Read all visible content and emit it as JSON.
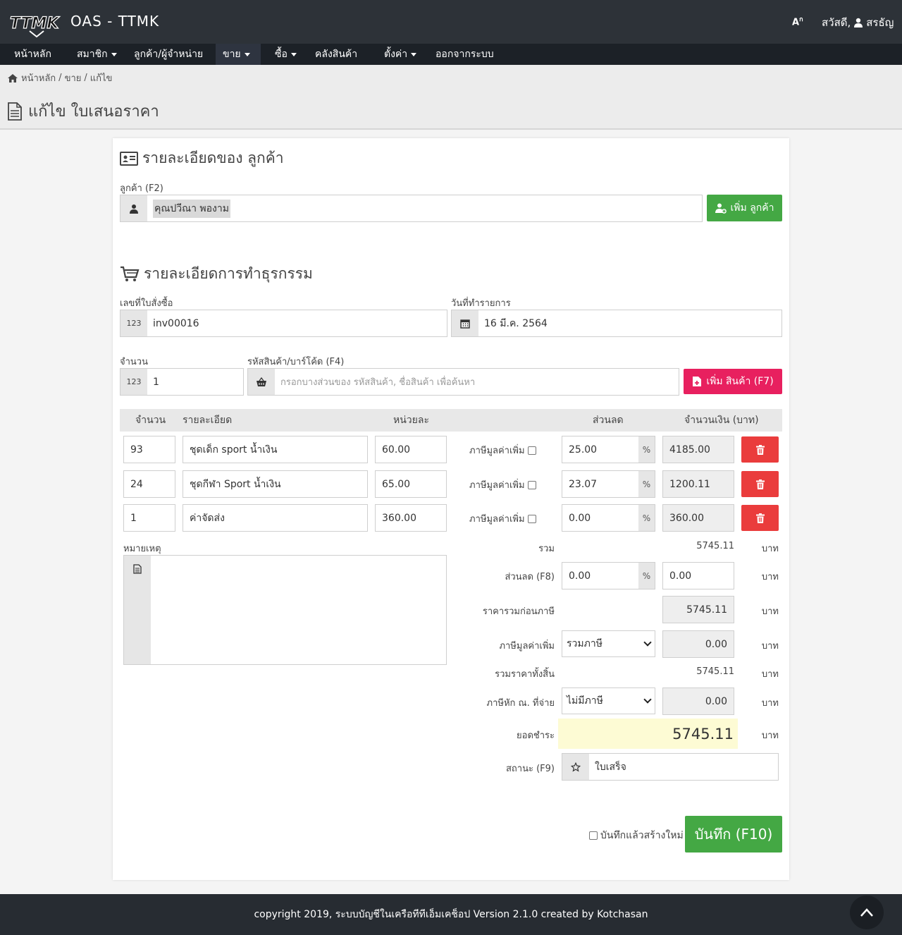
{
  "app": {
    "title": "OAS - TTMK",
    "logo_text": "TTMK"
  },
  "user": {
    "greeting": "สวัสดี,",
    "name": "สรธัญ",
    "lang_glyph": "A"
  },
  "menu": [
    {
      "label": "หน้าหลัก"
    },
    {
      "label": "สมาชิก"
    },
    {
      "label": "ลูกค้า/ผู้จำหน่าย"
    },
    {
      "label": "ขาย"
    },
    {
      "label": "ซื้อ"
    },
    {
      "label": "คลังสินค้า"
    },
    {
      "label": "ตั้งค่า"
    },
    {
      "label": "ออกจากระบบ"
    }
  ],
  "breadcrumb": {
    "home": "หน้าหลัก",
    "sep": "/",
    "section": "ขาย",
    "current": "แก้ไข"
  },
  "page_title": "แก้ไข ใบเสนอราคา",
  "customer_section": {
    "title": "รายละเอียดของ ลูกค้า",
    "label": "ลูกค้า (F2)",
    "value": "คุณปวีณา พองาม",
    "add_button": "เพิ่ม ลูกค้า"
  },
  "transaction_section": {
    "title": "รายละเอียดการทำธุรกรรม",
    "order_label": "เลขที่ใบสั่งซื้อ",
    "order_value": "inv00016",
    "date_label": "วันที่ทำรายการ",
    "date_value": "16 มี.ค. 2564",
    "qty_label": "จำนวน",
    "qty_value": "1",
    "code_label": "รหัสสินค้า/บาร์โค้ด (F4)",
    "code_placeholder": "กรอกบางส่วนของ รหัสสินค้า, ชื่อสินค้า เพื่อค้นหา",
    "add_product_button": "เพิ่ม สินค้า (F7)",
    "addon_num": "123"
  },
  "table": {
    "headers": {
      "qty": "จำนวน",
      "detail": "รายละเอียด",
      "unit": "หน่วยละ",
      "discount": "ส่วนลด",
      "amount": "จำนวนเงิน (บาท)"
    },
    "vat_label": "ภาษีมูลค่าเพิ่ม",
    "pct": "%",
    "rows": [
      {
        "qty": "93",
        "detail": "ชุดเด็ก sport น้ำเงิน",
        "unit": "60.00",
        "discount": "25.00",
        "amount": "4185.00"
      },
      {
        "qty": "24",
        "detail": "ชุดกีฬา Sport น้ำเงิน",
        "unit": "65.00",
        "discount": "23.07",
        "amount": "1200.11"
      },
      {
        "qty": "1",
        "detail": "ค่าจัดส่ง",
        "unit": "360.00",
        "discount": "0.00",
        "amount": "360.00"
      }
    ]
  },
  "note_label": "หมายเหตุ",
  "summary": {
    "currency": "บาท",
    "pct": "%",
    "total_label": "รวม",
    "total_value": "5745.11",
    "discount_label": "ส่วนลด (F8)",
    "discount_pct": "0.00",
    "discount_value": "0.00",
    "pretax_label": "ราคารวมก่อนภาษี",
    "pretax_value": "5745.11",
    "vat_label": "ภาษีมูลค่าเพิ่ม",
    "vat_select": "รวมภาษี",
    "vat_value": "0.00",
    "grand_label": "รวมราคาทั้งสิ้น",
    "grand_value": "5745.11",
    "wht_label": "ภาษีหัก ณ. ที่จ่าย",
    "wht_select": "ไม่มีภาษี",
    "wht_value": "0.00",
    "pay_label": "ยอดชำระ",
    "pay_value": "5745.11",
    "status_label": "สถานะ (F9)",
    "status_value": "ใบเสร็จ"
  },
  "actions": {
    "create_new_label": "บันทึกแล้วสร้างใหม่",
    "save_button": "บันทึก (F10)"
  },
  "footer": {
    "text": "copyright 2019, ระบบบัญชีในเครือทีทีเอ็มเคช็อป Version 2.1.0 created by Kotchasan",
    "totop": "^"
  },
  "colors": {
    "header": "#2d3238",
    "menubar": "#1c2127",
    "green": "#44a844",
    "pink": "#e8205f",
    "red": "#ea3c3c",
    "pay_bg": "#fdfbd4"
  }
}
